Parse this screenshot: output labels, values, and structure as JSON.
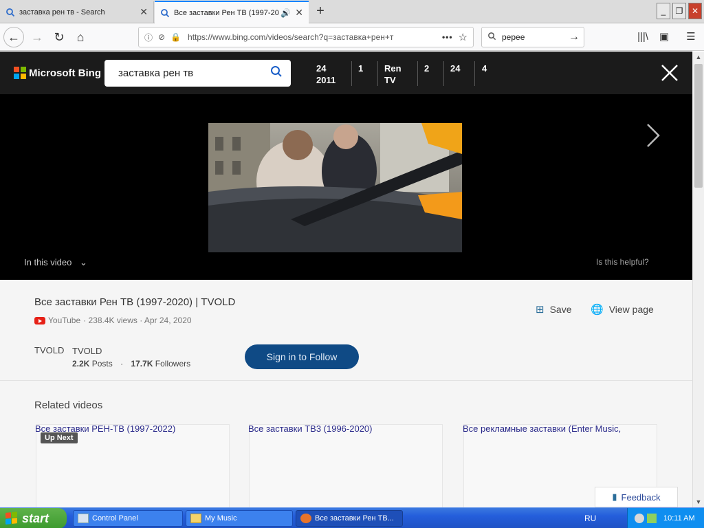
{
  "browser": {
    "tabs": [
      {
        "title": "заставка рен тв - Search"
      },
      {
        "title": "Все заставки Рен ТВ (1997-20"
      }
    ],
    "url": "https://www.bing.com/videos/search?q=заставка+рен+т",
    "search_box": "pepee"
  },
  "bing": {
    "logo_text": "Microsoft Bing",
    "query": "заставка рен тв",
    "chips": [
      {
        "line1": "24",
        "line2": "2011"
      },
      {
        "line1": "1",
        "line2": ""
      },
      {
        "line1": "Ren",
        "line2": "TV"
      },
      {
        "line1": "2",
        "line2": ""
      },
      {
        "line1": "24",
        "line2": ""
      },
      {
        "line1": "4",
        "line2": ""
      }
    ]
  },
  "player": {
    "in_this_video": "In this video",
    "helpful": "Is this helpful?"
  },
  "video": {
    "title": "Все заставки Рен ТВ (1997-2020) | TVOLD",
    "source": "YouTube",
    "meta": "· 238.4K views · Apr 24, 2020",
    "save_label": "Save",
    "view_page_label": "View page"
  },
  "channel": {
    "label": "TVOLD",
    "name": "TVOLD",
    "posts_count": "2.2K",
    "posts_label": "Posts",
    "followers_count": "17.7K",
    "followers_label": "Followers",
    "follow_button": "Sign in to Follow"
  },
  "related": {
    "heading": "Related videos",
    "items": [
      {
        "title": "Все заставки РЕН-ТВ (1997-2022)"
      },
      {
        "title": "Все заставки ТВ3 (1996-2020)"
      },
      {
        "title": "Все рекламные заставки (Enter Music,"
      }
    ],
    "up_next": "Up Next"
  },
  "feedback_label": "Feedback",
  "taskbar": {
    "start_label": "start",
    "tasks": [
      {
        "label": "Control Panel"
      },
      {
        "label": "My Music"
      },
      {
        "label": "Все заставки Рен ТВ..."
      }
    ],
    "language": "RU",
    "clock": "10:11 AM"
  }
}
